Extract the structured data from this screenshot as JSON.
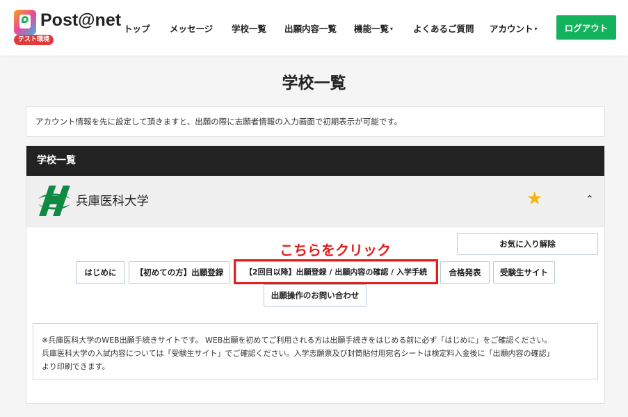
{
  "header": {
    "logo_text": "Post@net",
    "logo_badge": "テスト環境",
    "nav": [
      {
        "label": "トップ",
        "dropdown": false
      },
      {
        "label": "メッセージ",
        "dropdown": false
      },
      {
        "label": "学校一覧",
        "dropdown": false
      },
      {
        "label": "出願内容一覧",
        "dropdown": false
      },
      {
        "label": "機能一覧",
        "dropdown": true
      },
      {
        "label": "よくあるご質問",
        "dropdown": false
      },
      {
        "label": "アカウント",
        "dropdown": true
      }
    ],
    "logout_label": "ログアウト",
    "caret": "▾"
  },
  "page": {
    "title": "学校一覧",
    "info_text": "アカウント情報を先に設定して頂きますと、出願の際に志願者情報の入力画面で初期表示が可能です。"
  },
  "panel": {
    "title": "学校一覧",
    "school": {
      "name": "兵庫医科大学",
      "favorite_icon": "star-icon",
      "star_glyph": "★",
      "expand_glyph": "⌃",
      "favorite_remove_label": "お気に入り解除",
      "buttons": [
        "はじめに",
        "【初めての方】出願登録",
        "【2回目以降】出願登録 / 出願内容の確認 / 入学手続",
        "合格発表",
        "受験生サイト"
      ],
      "contact_label": "出願操作のお問い合わせ",
      "annotation": "こちらをクリック",
      "notes": [
        "※兵庫医科大学のWEB出願手続きサイトです。 WEB出願を初めてご利用される方は出願手続きをはじめる前に必ず「はじめに」をご確認ください。",
        "兵庫医科大学の入試内容については「受験生サイト」でご確認ください。入学志願票及び封筒貼付用宛名シートは検定料入金後に「出願内容の確認」",
        "より印刷できます。"
      ]
    }
  },
  "colors": {
    "logout_bg": "#13b25c",
    "panel_header_bg": "#222222",
    "star": "#f5b50a",
    "annotation": "#e41d1d",
    "school_logo": "#0f8a43"
  }
}
